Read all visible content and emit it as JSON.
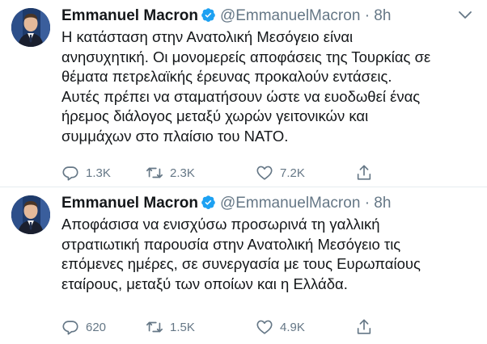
{
  "tweets": [
    {
      "author_name": "Emmanuel Macron",
      "handle": "@EmmanuelMacron",
      "separator": "·",
      "time": "8h",
      "lines": [
        "Η κατάσταση στην Ανατολική Μεσόγειο είναι",
        "ανησυχητική. Οι μονομερείς αποφάσεις της Τουρκίας σε",
        "θέματα πετρελαϊκής έρευνας προκαλούν εντάσεις.",
        "Αυτές πρέπει να σταματήσουν ώστε να ευοδωθεί ένας",
        "ήρεμος διάλογος μεταξύ χωρών γειτονικών και",
        "συμμάχων στο πλαίσιο του ΝΑΤΟ."
      ],
      "replies": "1.3K",
      "retweets": "2.3K",
      "likes": "7.2K"
    },
    {
      "author_name": "Emmanuel Macron",
      "handle": "@EmmanuelMacron",
      "separator": "·",
      "time": "8h",
      "lines": [
        "Αποφάσισα να ενισχύσω προσωρινά τη γαλλική",
        "στρατιωτική παρουσία στην Ανατολική Μεσόγειο τις",
        "επόμενες ημέρες, σε συνεργασία με τους Ευρωπαίους",
        "εταίρους, μεταξύ των οποίων και η Ελλάδα."
      ],
      "replies": "620",
      "retweets": "1.5K",
      "likes": "4.9K"
    }
  ],
  "colors": {
    "text": "#14171a",
    "secondary": "#657786",
    "verified_blue": "#1da1f2",
    "divider": "#e6ecf0"
  },
  "icons": [
    "avatar",
    "verified-badge-icon",
    "chevron-down-icon",
    "reply-icon",
    "retweet-icon",
    "like-icon",
    "share-icon"
  ]
}
